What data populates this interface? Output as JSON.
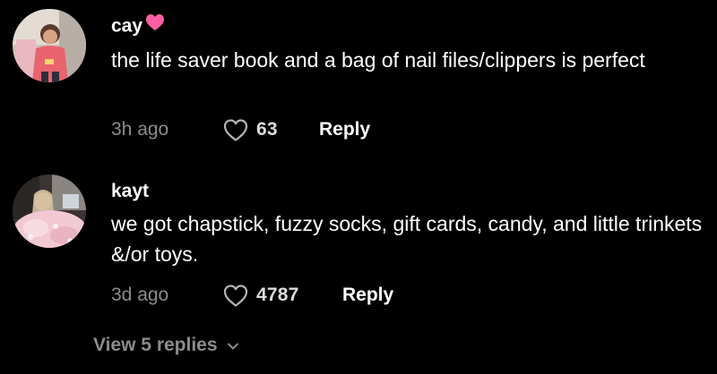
{
  "comments": [
    {
      "username": "cay",
      "badge_icon": "pink-heart-emoji",
      "text": "the life saver book and a bag of nail files/clippers is perfect",
      "time": "3h ago",
      "likes": "63",
      "reply_label": "Reply"
    },
    {
      "username": "kayt",
      "text": "we got chapstick, fuzzy socks, gift cards, candy, and little trinkets &/or toys.",
      "time": "3d ago",
      "likes": "4787",
      "reply_label": "Reply"
    }
  ],
  "view_replies_label": "View 5 replies",
  "colors": {
    "background": "#000000",
    "primary_text": "#ffffff",
    "secondary_text": "#8c8c8c",
    "heart_emoji": "#ff5fa2"
  },
  "icons": {
    "like": "heart-outline-icon",
    "expand": "chevron-down-icon"
  }
}
